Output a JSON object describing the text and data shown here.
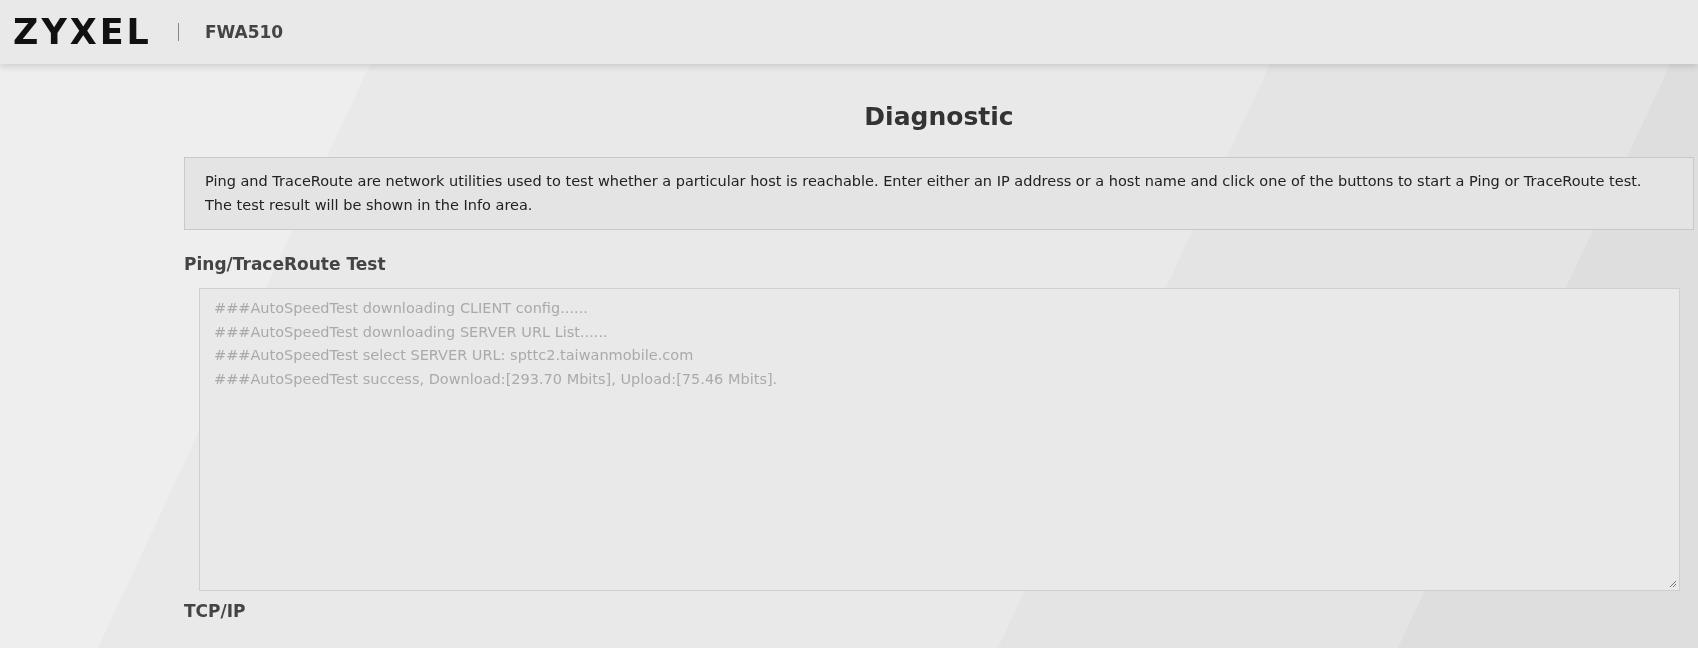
{
  "header": {
    "logo": "ZYXEL",
    "model": "FWA510"
  },
  "page_title": "Diagnostic",
  "info": "Ping and TraceRoute are network utilities used to test whether a particular host is reachable. Enter either an IP address or a host name and click one of the buttons to start a Ping or TraceRoute test. The test result will be shown in the Info area.",
  "sections": [
    {
      "title": "Ping/TraceRoute Test",
      "log": {
        "lines": [
          "###AutoSpeedTest downloading CLIENT config......",
          "###AutoSpeedTest downloading SERVER URL List......",
          "###AutoSpeedTest select SERVER URL: spttc2.taiwanmobile.com",
          "###AutoSpeedTest success, Download:[293.70 Mbits], Upload:[75.46 Mbits]."
        ],
        "disabled": true
      }
    },
    {
      "title": "TCP/IP"
    }
  ]
}
